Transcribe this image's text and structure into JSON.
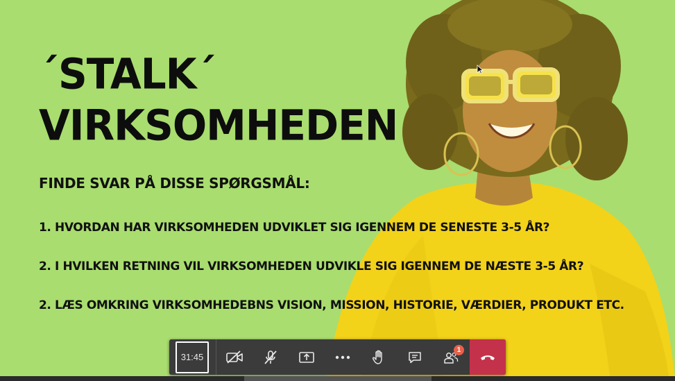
{
  "slide": {
    "title_line1": "´STALK´",
    "title_line2": "VIRKSOMHEDEN",
    "subtitle": "FINDE SVAR PÅ DISSE SPØRGSMÅL:",
    "questions": [
      "1. HVORDAN HAR VIRKSOMHEDEN UDVIKLET SIG IGENNEM DE SENESTE 3-5 ÅR?",
      "2. I HVILKEN RETNING VIL VIRKSOMHEDEN UDVIKLE SIG IGENNEM DE NÆSTE 3-5 ÅR?",
      "2. LÆS OMKRING VIRKSOMHEDEBNS VISION, MISSION, HISTORIE, VÆRDIER, PRODUKT ETC."
    ],
    "colors": {
      "background": "#a9dd6f",
      "sweater": "#f3d21a",
      "text": "#111111"
    }
  },
  "toolbar": {
    "timer": "31:45",
    "buttons": [
      {
        "name": "camera-off",
        "icon": "video-off-icon"
      },
      {
        "name": "mic-off",
        "icon": "mic-off-icon"
      },
      {
        "name": "share",
        "icon": "share-screen-icon"
      },
      {
        "name": "more",
        "icon": "more-icon"
      },
      {
        "name": "raise-hand",
        "icon": "hand-icon"
      },
      {
        "name": "chat",
        "icon": "chat-icon"
      },
      {
        "name": "participants",
        "icon": "people-icon"
      }
    ],
    "participants_badge": "1",
    "hangup_color": "#c4314b"
  }
}
